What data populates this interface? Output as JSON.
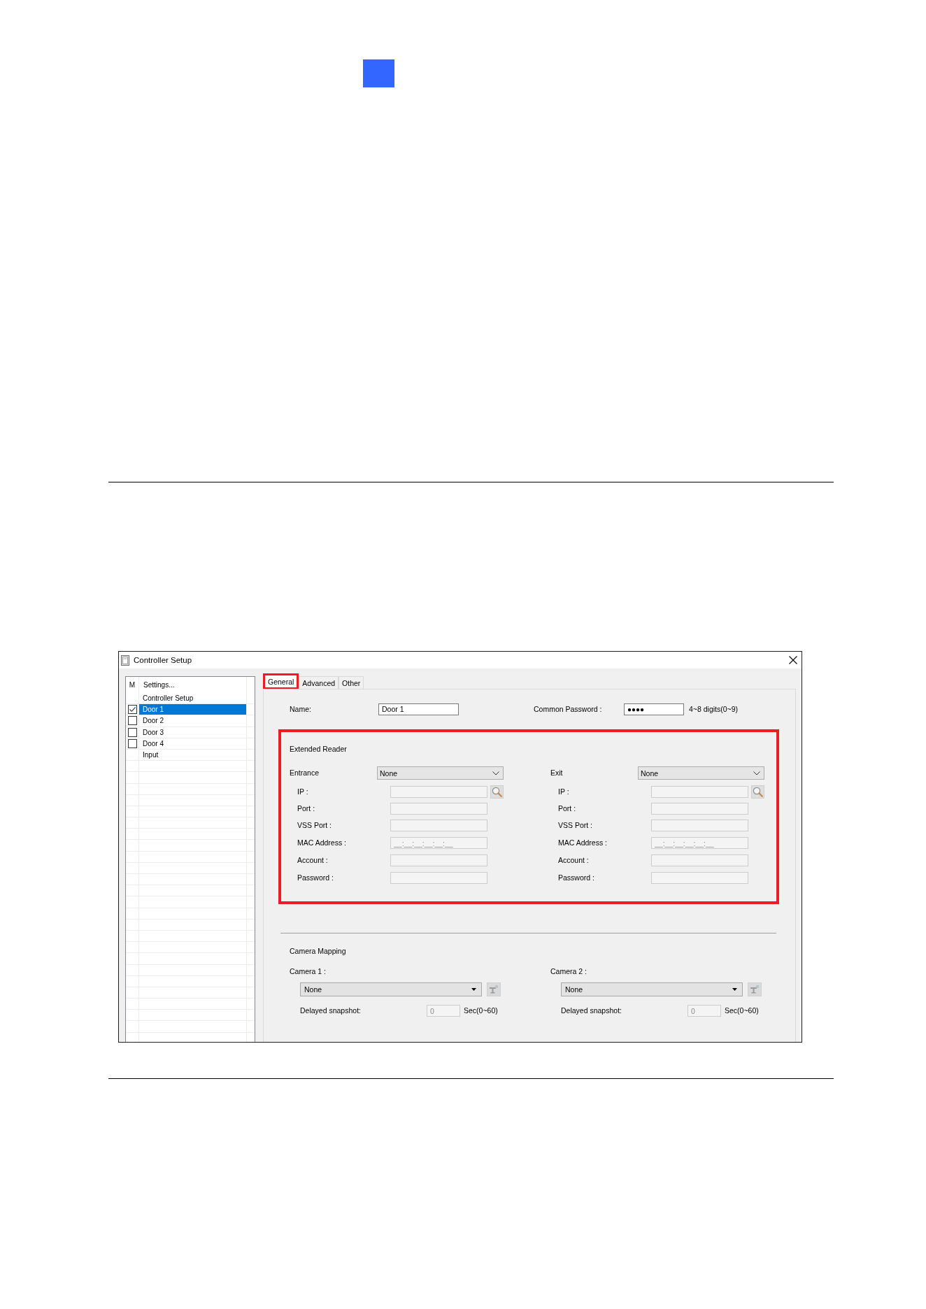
{
  "window": {
    "title": "Controller Setup"
  },
  "sidebar": {
    "columns": [
      "M",
      "Settings..."
    ],
    "items": [
      {
        "label": "Controller Setup",
        "kind": "plain",
        "selected": false
      },
      {
        "label": "Door 1",
        "kind": "checkbox",
        "checked": true,
        "selected": true
      },
      {
        "label": "Door 2",
        "kind": "checkbox",
        "checked": false,
        "selected": false
      },
      {
        "label": "Door 3",
        "kind": "checkbox",
        "checked": false,
        "selected": false
      },
      {
        "label": "Door 4",
        "kind": "checkbox",
        "checked": false,
        "selected": false
      },
      {
        "label": "Input",
        "kind": "plain",
        "selected": false
      }
    ]
  },
  "tabs": [
    {
      "label": "General",
      "selected": true,
      "highlighted": true
    },
    {
      "label": "Advanced",
      "selected": false,
      "highlighted": false
    },
    {
      "label": "Other",
      "selected": false,
      "highlighted": false
    }
  ],
  "general": {
    "name": {
      "label": "Name:",
      "value": "Door 1"
    },
    "common_password": {
      "label": "Common Password :",
      "value": "●●●●",
      "hint": "4~8 digits(0~9)"
    },
    "extended_reader": {
      "title": "Extended Reader",
      "highlighted": true,
      "readers": [
        {
          "label": "Entrance",
          "selection": "None",
          "fields": [
            {
              "label": "IP :",
              "kind": "search",
              "disabled": true
            },
            {
              "label": "Port :",
              "kind": "text",
              "disabled": true
            },
            {
              "label": "VSS Port :",
              "kind": "text",
              "disabled": true
            },
            {
              "label": "MAC Address :",
              "kind": "text",
              "placeholder": "__:__:__:__:__:__",
              "disabled": true
            },
            {
              "label": "Account :",
              "kind": "text",
              "disabled": true
            },
            {
              "label": "Password :",
              "kind": "text",
              "disabled": true
            }
          ]
        },
        {
          "label": "Exit",
          "selection": "None",
          "fields": [
            {
              "label": "IP :",
              "kind": "search",
              "disabled": true
            },
            {
              "label": "Port :",
              "kind": "text",
              "disabled": true
            },
            {
              "label": "VSS Port :",
              "kind": "text",
              "disabled": true
            },
            {
              "label": "MAC Address :",
              "kind": "text",
              "placeholder": "__:__:__:__:__:__",
              "disabled": true
            },
            {
              "label": "Account :",
              "kind": "text",
              "disabled": true
            },
            {
              "label": "Password :",
              "kind": "text",
              "disabled": true
            }
          ]
        }
      ]
    },
    "camera_mapping": {
      "title": "Camera Mapping",
      "cameras": [
        {
          "label": "Camera 1 :",
          "selection": "None",
          "snapshot_label": "Delayed snapshot:",
          "snapshot_value": "0",
          "snapshot_disabled": true,
          "unit": "Sec(0~60)"
        },
        {
          "label": "Camera 2 :",
          "selection": "None",
          "snapshot_label": "Delayed snapshot:",
          "snapshot_value": "0",
          "snapshot_disabled": true,
          "unit": "Sec(0~60)"
        }
      ]
    }
  }
}
